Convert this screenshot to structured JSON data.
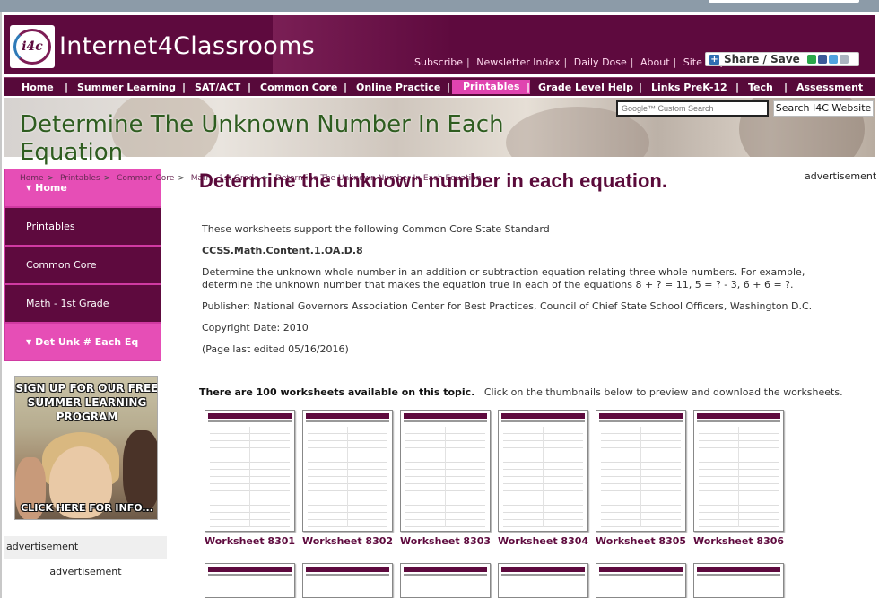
{
  "site": {
    "title": "Internet4Classrooms",
    "logo_text": "i4c",
    "top_links": [
      "Subscribe",
      "Newsletter Index",
      "Daily Dose",
      "About",
      "Site Map"
    ],
    "share_label": "Share / Save"
  },
  "nav": {
    "items": [
      {
        "label": "Home"
      },
      {
        "label": "Summer Learning"
      },
      {
        "label": "SAT/ACT"
      },
      {
        "label": "Common Core"
      },
      {
        "label": "Online Practice"
      },
      {
        "label": "Printables",
        "active": true
      },
      {
        "label": "Grade Level Help"
      },
      {
        "label": "Links PreK-12"
      },
      {
        "label": "Tech"
      },
      {
        "label": "Assessment"
      }
    ]
  },
  "banner": {
    "heading": "Determine The Unknown Number In Each Equation"
  },
  "search": {
    "placeholder": "Google™ Custom Search",
    "button_label": "Search I4C Website"
  },
  "breadcrumb": [
    "Home",
    "Printables",
    "Common Core",
    "Math - 1st Grade",
    "Determine The Unknown Number In Each Equation"
  ],
  "sidebar": {
    "items": [
      {
        "label": "Home",
        "active": true
      },
      {
        "label": "Printables",
        "active": false
      },
      {
        "label": "Common Core",
        "active": false
      },
      {
        "label": "Math - 1st Grade",
        "active": false
      },
      {
        "label": "Det Unk # Each Eq",
        "active": true
      }
    ]
  },
  "promo": {
    "headline": "SIGN UP FOR OUR FREE SUMMER LEARNING PROGRAM",
    "cta": "CLICK HERE FOR INFO..."
  },
  "ads": {
    "left_label": "advertisement",
    "left_label2": "advertisement",
    "right_label": "advertisement"
  },
  "main": {
    "title": "Determine the unknown number in each equation.",
    "intro": "These worksheets support the following Common Core State Standard",
    "standard_code": "CCSS.Math.Content.1.OA.D.8",
    "description": "Determine the unknown whole number in an addition or subtraction equation relating three whole numbers. For example, determine the unknown number that makes the equation true in each of the equations 8 + ? = 11, 5 = ? - 3, 6 + 6 = ?.",
    "publisher": "Publisher: National Governors Association Center for Best Practices, Council of Chief State School Officers, Washington D.C.",
    "copyright": "Copyright Date: 2010",
    "edited": "(Page last edited 05/16/2016)"
  },
  "worksheets": {
    "count_text": "There are 100 worksheets available on this topic.",
    "instruction": "Click on the thumbnails below to preview and download the worksheets.",
    "items": [
      {
        "label": "Worksheet 8301"
      },
      {
        "label": "Worksheet 8302"
      },
      {
        "label": "Worksheet 8303"
      },
      {
        "label": "Worksheet 8304"
      },
      {
        "label": "Worksheet 8305"
      },
      {
        "label": "Worksheet 8306"
      }
    ]
  },
  "colors": {
    "brand_dark": "#5e0a3e",
    "brand_pink": "#e64eb6",
    "heading_green": "#2f5d20"
  }
}
